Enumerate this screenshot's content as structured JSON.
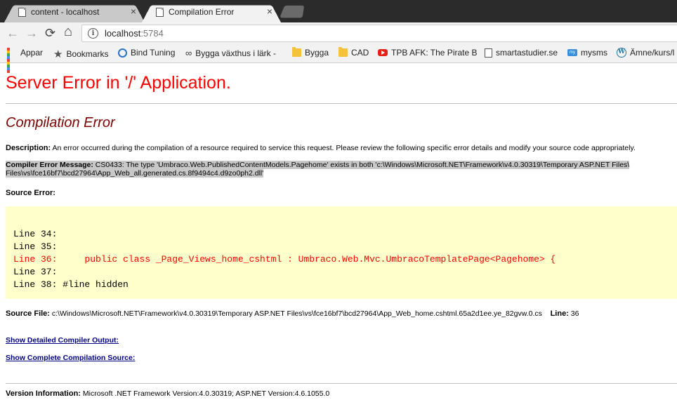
{
  "tabs": [
    {
      "title": "content - localhost",
      "close": "×"
    },
    {
      "title": "Compilation Error",
      "close": "×"
    }
  ],
  "toolbar": {
    "back": "←",
    "forward": "→",
    "reload": "⟳",
    "home": "⌂",
    "url_host": "localhost",
    "url_port": ":5784",
    "info": "i"
  },
  "bookmarks": [
    {
      "label": "Appar",
      "icon": "apps-icon"
    },
    {
      "label": "Bookmarks",
      "icon": "star-icon"
    },
    {
      "label": "Bind Tuning",
      "icon": "bind-tuning-icon"
    },
    {
      "label": "Bygga växthus i lärk -",
      "icon": "link-icon"
    },
    {
      "label": "Bygga",
      "icon": "folder-icon"
    },
    {
      "label": "CAD",
      "icon": "folder-icon"
    },
    {
      "label": "TPB AFK: The Pirate B",
      "icon": "youtube-icon"
    },
    {
      "label": "smartastudier.se",
      "icon": "page-icon"
    },
    {
      "label": "mysms",
      "icon": "mysms-icon"
    },
    {
      "label": "Ämne/kurs/l",
      "icon": "wordpress-icon"
    }
  ],
  "page": {
    "title": "Server Error in '/' Application.",
    "subtitle": "Compilation Error",
    "description_label": "Description:",
    "description_text": "An error occurred during the compilation of a resource required to service this request. Please review the following specific error details and modify your source code appropriately.",
    "compiler_label": "Compiler Error Message:",
    "compiler_text": "CS0433: The type 'Umbraco.Web.PublishedContentModels.Pagehome' exists in both 'c:\\Windows\\Microsoft.NET\\Framework\\v4.0.30319\\Temporary ASP.NET Files\\vs\\fce16bf7\\bcd27964\\App_Web_all.generated.cs.8f9494c4.d9zo0ph2.dll'",
    "compiler_line1": "CS0433: The type 'Umbraco.Web.PublishedContentModels.Pagehome' exists in both 'c:\\Windows\\Microsoft.NET\\Framework\\v4.0.30319\\Temporary ASP.NET Files\\",
    "compiler_line2": "Files\\vs\\fce16bf7\\bcd27964\\App_Web_all.generated.cs.8f9494c4.d9zo0ph2.dll'",
    "source_error_label": "Source Error:",
    "code_lines": [
      "Line 34:",
      "Line 35:",
      "Line 36:     public class _Page_Views_home_cshtml : Umbraco.Web.Mvc.UmbracoTemplatePage<Pagehome> {",
      "Line 37:",
      "Line 38: #line hidden"
    ],
    "error_line_index": 2,
    "source_file_label": "Source File:",
    "source_file_text": "c:\\Windows\\Microsoft.NET\\Framework\\v4.0.30319\\Temporary ASP.NET Files\\vs\\fce16bf7\\bcd27964\\App_Web_home.cshtml.65a2d1ee.ye_82gvw.0.cs",
    "line_label": "Line:",
    "line_value": "36",
    "link_compiler_output": "Show Detailed Compiler Output:",
    "link_compilation_source": "Show Complete Compilation Source:",
    "version_label": "Version Information:",
    "version_text": "Microsoft .NET Framework Version:4.0.30319; ASP.NET Version:4.6.1055.0"
  },
  "colors": {
    "title": "#ff0000",
    "subtitle": "#800000",
    "code_bg": "#ffffcc",
    "error_line": "#ff0000",
    "link": "#000080"
  }
}
